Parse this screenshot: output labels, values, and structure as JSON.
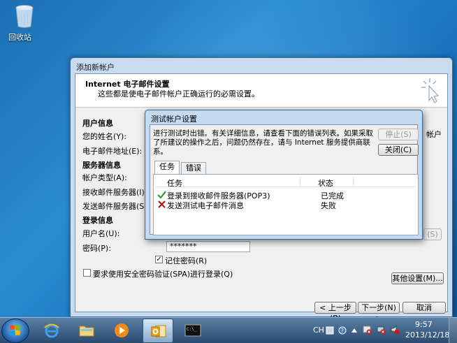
{
  "desktop": {
    "recycle_bin_label": "回收站"
  },
  "wizard": {
    "title": "添加新帐户",
    "header_title": "Internet 电子邮件设置",
    "header_subtitle": "这些都是使电子邮件帐户正确运行的必需设置。",
    "user_info_heading": "用户信息",
    "your_name_label": "您的姓名(Y):",
    "email_label": "电子邮件地址(E):",
    "server_info_heading": "服务器信息",
    "account_type_label": "帐户类型(A):",
    "incoming_label": "接收邮件服务器(I):",
    "outgoing_label": "发送邮件服务器(SMTP",
    "login_info_heading": "登录信息",
    "username_label": "用户名(U):",
    "password_label": "密码(P):",
    "password_value": "*******",
    "remember_password_label": "记住密码(R)",
    "remember_password_checked": true,
    "spa_label": "要求使用安全密码验证(SPA)进行登录(Q)",
    "spa_checked": false,
    "right_cut_text": "帐户",
    "right_cut_button": "(S)",
    "more_settings_button": "其他设置(M)...",
    "back_button": "< 上一步(B)",
    "next_button": "下一步(N) >",
    "cancel_button": "取消"
  },
  "test_dialog": {
    "title": "测试帐户设置",
    "message": "进行测试时出错。有关详细信息，请查看下面的错误列表。如果采取了所建议的操作之后，问题仍然存在，请与 Internet 服务提供商联系。",
    "stop_button": "停止(S)",
    "close_button": "关闭(C)",
    "tabs": [
      "任务",
      "错误"
    ],
    "active_tab": 0,
    "columns": [
      "任务",
      "状态"
    ],
    "rows": [
      {
        "task": "登录到接收邮件服务器(POP3)",
        "status": "已完成",
        "result": "success"
      },
      {
        "task": "发送测试电子邮件消息",
        "status": "失败",
        "result": "failure"
      }
    ]
  },
  "taskbar": {
    "language": "CH",
    "time": "9:57",
    "date": "2013/12/18",
    "apps": [
      "start",
      "internet-explorer",
      "file-explorer",
      "media-player",
      "outlook",
      "command-prompt"
    ],
    "active_app": "outlook"
  },
  "colors": {
    "success": "#2e9a2e",
    "failure": "#b01818"
  }
}
